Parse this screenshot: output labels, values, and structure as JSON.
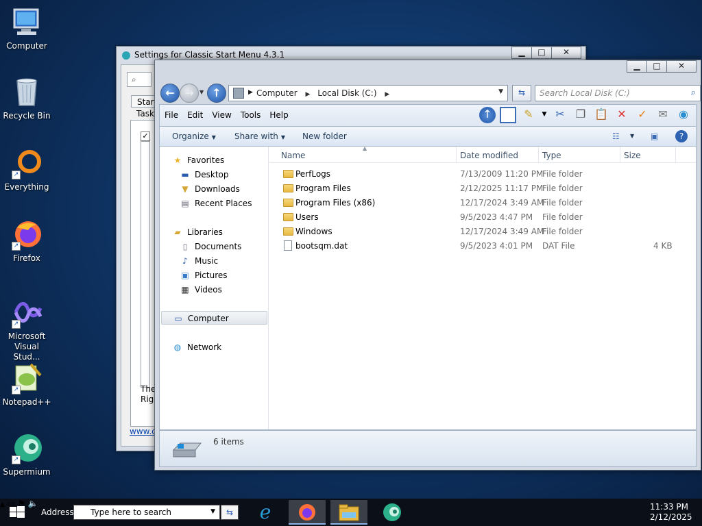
{
  "desktop": {
    "icons": [
      {
        "label": "Computer",
        "icon": "computer-icon"
      },
      {
        "label": "Recycle Bin",
        "icon": "recycle-bin-icon"
      },
      {
        "label": "Everything",
        "icon": "everything-icon"
      },
      {
        "label": "Firefox",
        "icon": "firefox-icon"
      },
      {
        "label": "Microsoft Visual Stud...",
        "icon": "visual-studio-icon"
      },
      {
        "label": "Notepad++",
        "icon": "notepadpp-icon"
      },
      {
        "label": "Supermium",
        "icon": "supermium-icon"
      }
    ]
  },
  "back_window": {
    "title": "Settings for Classic Start Menu 4.3.1",
    "tab_start": "Start",
    "tab_task": "Task",
    "text_the": "The",
    "text_righ": "Righ",
    "link": "www.c"
  },
  "explorer": {
    "address": {
      "crumbs": [
        "Computer",
        "Local Disk (C:)"
      ]
    },
    "search_placeholder": "Search Local Disk (C:)",
    "menu": [
      "File",
      "Edit",
      "View",
      "Tools",
      "Help"
    ],
    "commands": {
      "organize": "Organize",
      "share": "Share with",
      "new_folder": "New folder"
    },
    "nav": {
      "favorites": "Favorites",
      "desktop": "Desktop",
      "downloads": "Downloads",
      "recent": "Recent Places",
      "libraries": "Libraries",
      "documents": "Documents",
      "music": "Music",
      "pictures": "Pictures",
      "videos": "Videos",
      "computer": "Computer",
      "network": "Network"
    },
    "columns": {
      "name": "Name",
      "date": "Date modified",
      "type": "Type",
      "size": "Size"
    },
    "files": [
      {
        "name": "PerfLogs",
        "date": "7/13/2009 11:20 PM",
        "type": "File folder",
        "size": "",
        "kind": "folder"
      },
      {
        "name": "Program Files",
        "date": "2/12/2025 11:17 PM",
        "type": "File folder",
        "size": "",
        "kind": "folder"
      },
      {
        "name": "Program Files (x86)",
        "date": "12/17/2024 3:49 AM",
        "type": "File folder",
        "size": "",
        "kind": "folder"
      },
      {
        "name": "Users",
        "date": "9/5/2023 4:47 PM",
        "type": "File folder",
        "size": "",
        "kind": "folder"
      },
      {
        "name": "Windows",
        "date": "12/17/2024 3:49 AM",
        "type": "File folder",
        "size": "",
        "kind": "folder"
      },
      {
        "name": "bootsqm.dat",
        "date": "9/5/2023 4:01 PM",
        "type": "DAT File",
        "size": "4 KB",
        "kind": "file"
      }
    ],
    "status": "6 items"
  },
  "taskbar": {
    "address_label": "Address",
    "search_value": "Type here to search",
    "time": "11:33 PM",
    "date": "2/12/2025"
  }
}
